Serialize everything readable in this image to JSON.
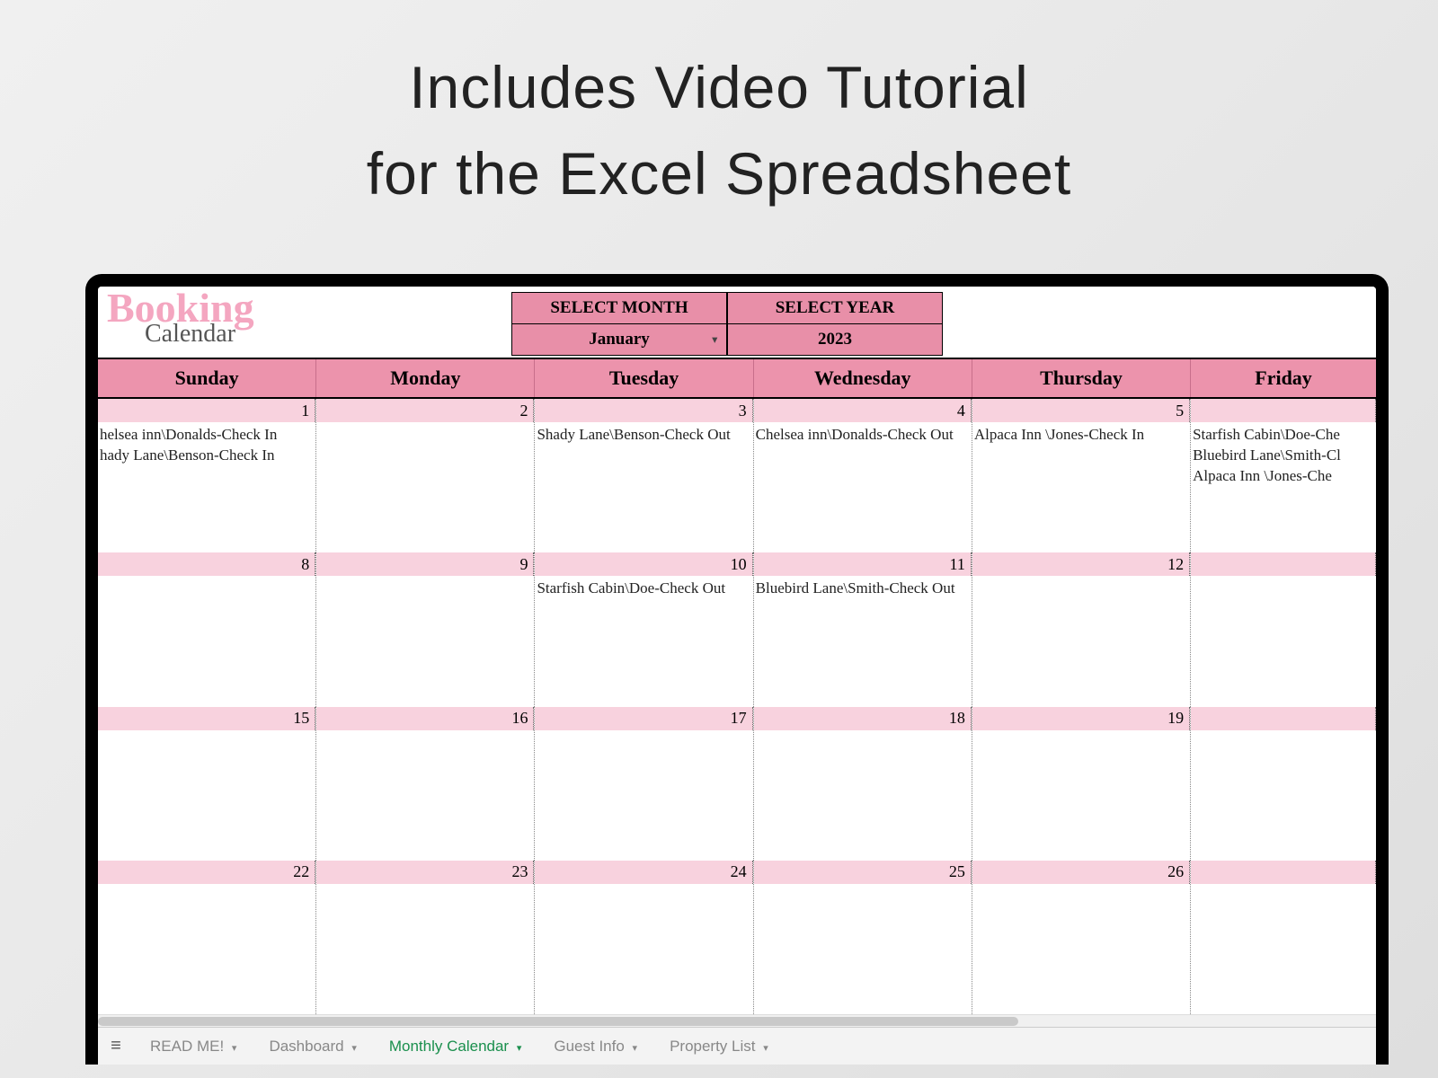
{
  "headline": {
    "line1": "Includes Video Tutorial",
    "line2": "for the Excel Spreadsheet"
  },
  "brand": {
    "script": "Booking",
    "sub": "Calendar"
  },
  "selectors": {
    "month_label": "SELECT MONTH",
    "month_value": "January",
    "year_label": "SELECT YEAR",
    "year_value": "2023"
  },
  "day_headers": [
    "Sunday",
    "Monday",
    "Tuesday",
    "Wednesday",
    "Thursday",
    "Friday"
  ],
  "weeks": [
    {
      "dates": [
        "1",
        "2",
        "3",
        "4",
        "5",
        ""
      ],
      "events": [
        [
          "helsea inn\\Donalds-Check In",
          "hady Lane\\Benson-Check In"
        ],
        [],
        [
          "Shady Lane\\Benson-Check Out"
        ],
        [
          "Chelsea inn\\Donalds-Check Out"
        ],
        [
          "Alpaca Inn   \\Jones-Check In"
        ],
        [
          "Starfish Cabin\\Doe-Che",
          "Bluebird Lane\\Smith-Cl",
          "Alpaca Inn   \\Jones-Che"
        ]
      ]
    },
    {
      "dates": [
        "8",
        "9",
        "10",
        "11",
        "12",
        ""
      ],
      "events": [
        [],
        [],
        [
          "Starfish Cabin\\Doe-Check Out"
        ],
        [
          "Bluebird Lane\\Smith-Check Out"
        ],
        [],
        []
      ]
    },
    {
      "dates": [
        "15",
        "16",
        "17",
        "18",
        "19",
        ""
      ],
      "events": [
        [],
        [],
        [],
        [],
        [],
        []
      ]
    },
    {
      "dates": [
        "22",
        "23",
        "24",
        "25",
        "26",
        ""
      ],
      "events": [
        [],
        [],
        [],
        [],
        [],
        []
      ]
    }
  ],
  "tabs": {
    "items": [
      "READ ME!",
      "Dashboard",
      "Monthly Calendar",
      "Guest Info",
      "Property List"
    ],
    "active_index": 2
  }
}
